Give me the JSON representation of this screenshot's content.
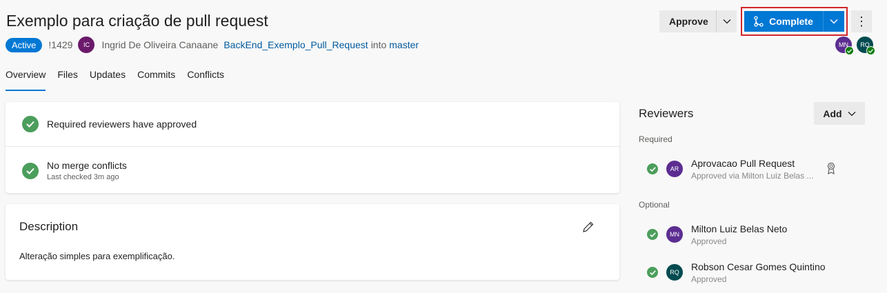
{
  "pr": {
    "title": "Exemplo para criação de pull request",
    "status": "Active",
    "id": "!1429",
    "author_initials": "IC",
    "author": "Ingrid De Oliveira Canaane",
    "source_branch": "BackEnd_Exemplo_Pull_Request",
    "into_text": "into",
    "target_branch": "master"
  },
  "actions": {
    "approve_label": "Approve",
    "complete_label": "Complete",
    "more_label": "⋮"
  },
  "header_reviewers": [
    {
      "initials": "MN",
      "color": "#5c2d91"
    },
    {
      "initials": "RQ",
      "color": "#004b50"
    }
  ],
  "tabs": [
    {
      "label": "Overview",
      "active": true
    },
    {
      "label": "Files",
      "active": false
    },
    {
      "label": "Updates",
      "active": false
    },
    {
      "label": "Commits",
      "active": false
    },
    {
      "label": "Conflicts",
      "active": false
    }
  ],
  "status_checks": [
    {
      "text": "Required reviewers have approved",
      "sub": ""
    },
    {
      "text": "No merge conflicts",
      "sub": "Last checked 3m ago"
    }
  ],
  "description": {
    "title": "Description",
    "text": "Alteração simples para exemplificação."
  },
  "reviewers_panel": {
    "title": "Reviewers",
    "add_label": "Add",
    "required_label": "Required",
    "optional_label": "Optional",
    "required": [
      {
        "initials": "AR",
        "name": "Aprovacao Pull Request",
        "sub": "Approved via Milton Luiz Belas ...",
        "color": "#5c2d91"
      }
    ],
    "optional": [
      {
        "initials": "MN",
        "name": "Milton Luiz Belas Neto",
        "sub": "Approved",
        "color": "#5c2d91"
      },
      {
        "initials": "RQ",
        "name": "Robson Cesar Gomes Quintino",
        "sub": "Approved",
        "color": "#004b50"
      }
    ]
  },
  "colors": {
    "accent": "#0078d4",
    "success": "#4c9e5c",
    "highlight_border": "#d1262b"
  }
}
